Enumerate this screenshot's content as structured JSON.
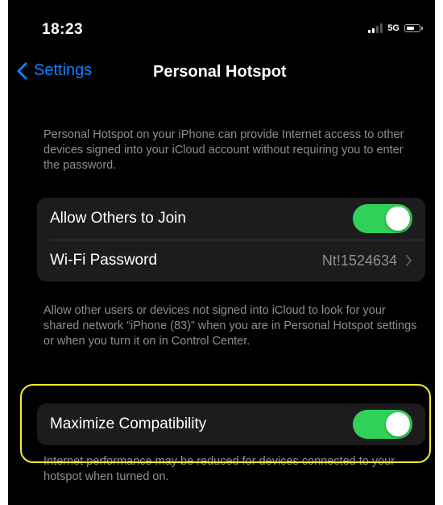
{
  "status_bar": {
    "time": "18:23",
    "network": "5G",
    "signal_bars": 4,
    "signal_active": 2
  },
  "nav": {
    "back_label": "Settings",
    "title": "Personal Hotspot"
  },
  "intro_text": "Personal Hotspot on your iPhone can provide Internet access to other devices signed into your iCloud account without requiring you to enter the password.",
  "settings_group": {
    "allow_others": {
      "label": "Allow Others to Join",
      "on": true
    },
    "wifi_password": {
      "label": "Wi-Fi Password",
      "value": "Nt!1524634"
    }
  },
  "network_footnote": "Allow other users or devices not signed into iCloud to look for your shared network “iPhone (83)” when you are in Personal Hotspot settings or when you turn it on in Control Center.",
  "compatibility": {
    "label": "Maximize Compatibility",
    "on": true,
    "footnote": "Internet performance may be reduced for devices connected to your hotspot when turned on."
  },
  "colors": {
    "background": "#000000",
    "cell": "#1c1c1e",
    "accent_blue": "#0a84ff",
    "toggle_on": "#30d158",
    "highlight": "#f2ee29",
    "secondary_text": "#8e8e93"
  },
  "icons": {
    "back": "chevron-left-icon",
    "disclosure": "chevron-right-icon"
  }
}
